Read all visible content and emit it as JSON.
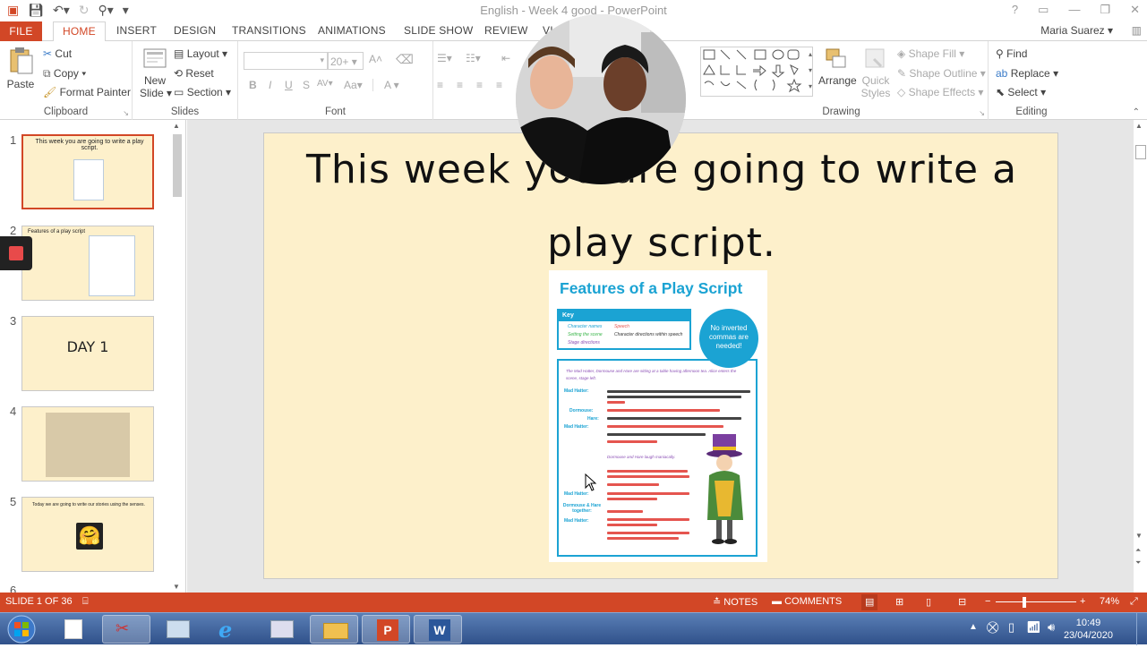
{
  "window": {
    "title": "English - Week 4 good - PowerPoint",
    "controls": [
      "?",
      "▭",
      "—",
      "❐",
      "✕"
    ]
  },
  "ribbon_tabs": [
    "FILE",
    "HOME",
    "INSERT",
    "DESIGN",
    "TRANSITIONS",
    "ANIMATIONS",
    "SLIDE SHOW",
    "REVIEW",
    "VI"
  ],
  "user": "Maria Suarez",
  "clipboard": {
    "paste": "Paste",
    "cut": "Cut",
    "copy": "Copy",
    "format_painter": "Format Painter",
    "label": "Clipboard"
  },
  "slides_group": {
    "new_slide_1": "New",
    "new_slide_2": "Slide",
    "layout": "Layout",
    "reset": "Reset",
    "section": "Section",
    "label": "Slides"
  },
  "font_group": {
    "font_size": "20+",
    "label": "Font",
    "bold": "B",
    "italic": "I",
    "underline": "U",
    "shadow": "S",
    "spacing": "AV",
    "case": "Aa",
    "color": "A"
  },
  "drawing_group": {
    "arrange": "Arrange",
    "quick_styles_1": "Quick",
    "quick_styles_2": "Styles",
    "shape_fill": "Shape Fill",
    "shape_outline": "Shape Outline",
    "shape_effects": "Shape Effects",
    "label": "Drawing"
  },
  "editing_group": {
    "find": "Find",
    "replace": "Replace",
    "select": "Select",
    "label": "Editing"
  },
  "thumbnails": [
    {
      "num": "1",
      "text": "This week you are going to write a play script."
    },
    {
      "num": "2",
      "text": "Features of a play script"
    },
    {
      "num": "3",
      "text": "DAY 1"
    },
    {
      "num": "4",
      "text": ""
    },
    {
      "num": "5",
      "text": "Today we are going to write our stories using the senses."
    },
    {
      "num": "6",
      "text": ""
    }
  ],
  "slide": {
    "title_line1": "This week you are going to write a",
    "title_line2": "play script.",
    "doc_title": "Features of a Play Script",
    "key_label": "Key",
    "key_items": [
      "Character names",
      "Speech",
      "Setting the scene",
      "Character directions within speech",
      "Stage directions"
    ],
    "circle_text": "No inverted commas are needed!",
    "script_intro": "The Mad Hatter, Dormouse and Hare are sitting at a table having afternoon tea. Alice enters the scene, stage left.",
    "speakers": [
      "Mad Hatter:",
      "Dormouse:",
      "Hare:",
      "Mad Hatter:",
      "Mad Hatter:",
      "Dormouse & Hare together:",
      "Mad Hatter:"
    ],
    "stage_direction": "Dormouse and Hare laugh maniacally."
  },
  "status": {
    "slide_of": "SLIDE 1 OF 36",
    "notes": "NOTES",
    "comments": "COMMENTS",
    "zoom": "74%"
  },
  "taskbar": {
    "time": "10:49",
    "date": "23/04/2020"
  },
  "colors": {
    "accent": "#d24726",
    "slide_bg": "#fdf0cb",
    "doc_blue": "#1ba3d3"
  }
}
